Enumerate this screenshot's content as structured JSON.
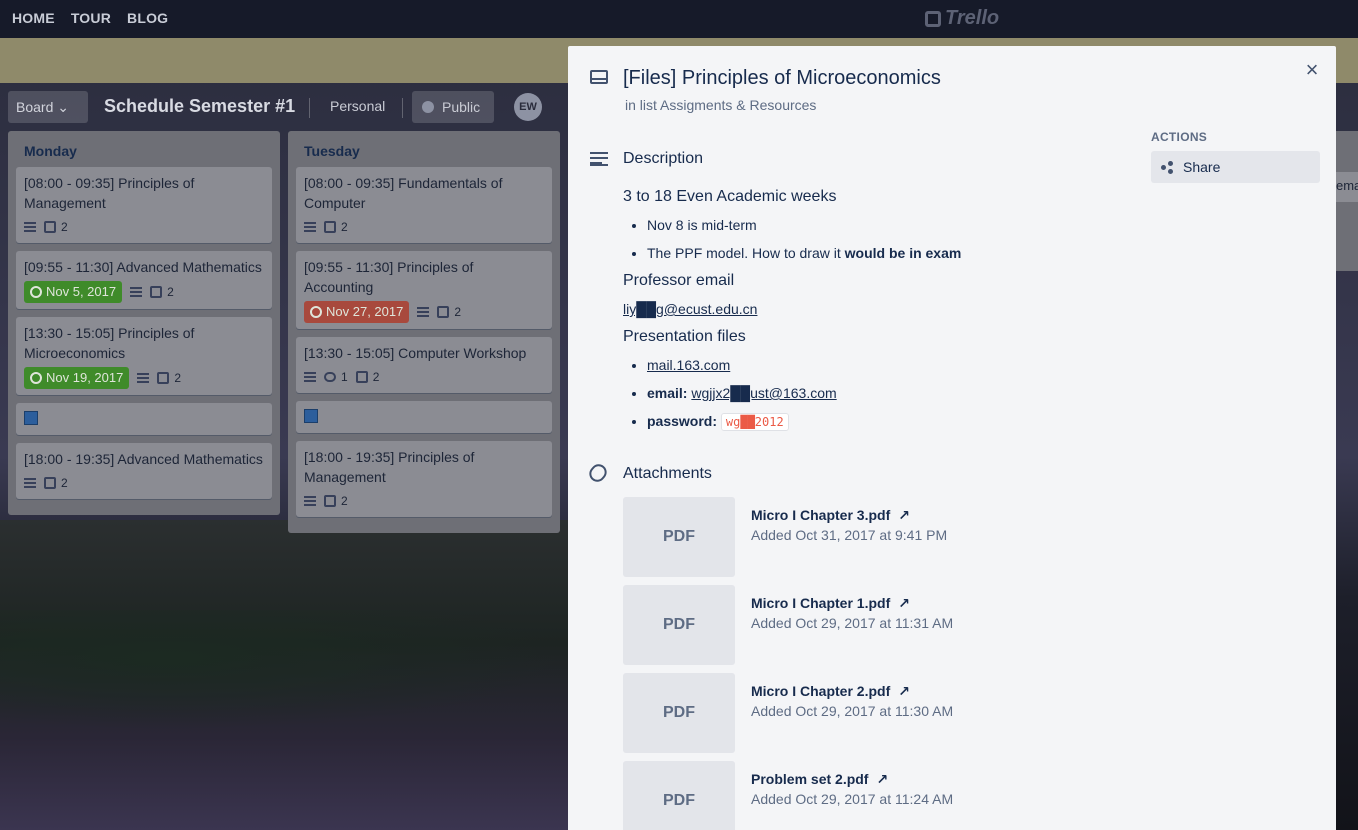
{
  "topnav": {
    "links": [
      "HOME",
      "TOUR",
      "BLOG"
    ],
    "logo": "Trello"
  },
  "board": {
    "switcher_label": "Board",
    "title": "Schedule Semester #1",
    "team": "Personal",
    "visibility": "Public",
    "avatar_initials": "EW"
  },
  "lists": [
    {
      "title": "Monday",
      "cards": [
        {
          "title": "[08:00 - 09:35] Principles of Management",
          "attachments": "2"
        },
        {
          "title": "[09:55 - 11:30] Advanced Mathematics",
          "due": "Nov 5, 2017",
          "due_status": "complete",
          "attachments": "2"
        },
        {
          "title": "[13:30 - 15:05] Principles of Microeconomics",
          "due": "Nov 19, 2017",
          "due_status": "complete",
          "attachments": "2"
        },
        {
          "title": "[18:00 - 19:35] Advanced Mathematics",
          "attachments": "2"
        }
      ]
    },
    {
      "title": "Tuesday",
      "cards": [
        {
          "title": "[08:00 - 09:35] Fundamentals of Computer",
          "attachments": "2"
        },
        {
          "title": "[09:55 - 11:30] Principles of Accounting",
          "due": "Nov 27, 2017",
          "due_status": "overdue",
          "attachments": "2"
        },
        {
          "title": "[13:30 - 15:05] Computer Workshop",
          "comments": "1",
          "attachments": "2"
        },
        {
          "title": "[18:00 - 19:35] Principles of Management",
          "attachments": "2"
        }
      ]
    }
  ],
  "peek_text": "ema",
  "modal": {
    "title": "[Files] Principles of Microeconomics",
    "in_list_prefix": "in list",
    "list_name": "Assigments & Resources",
    "description_heading": "Description",
    "description": {
      "h1": "3 to 18 Even Academic weeks",
      "bullets": [
        "Nov 8 is mid-term",
        "The PPF model. How to draw it "
      ],
      "bullet2_bold": "would be in exam",
      "h2": "Professor email",
      "prof_email": "liy██g@ecust.edu.cn",
      "h3": "Presentation files",
      "link1": "mail.163.com",
      "email_label": "email:",
      "email_value": "wgjjx2██ust@163.com",
      "password_label": "password:",
      "password_value": "wg██2012"
    },
    "attachments_heading": "Attachments",
    "attachments": [
      {
        "thumb": "PDF",
        "name": "Micro I Chapter 3.pdf",
        "added": "Added Oct 31, 2017 at 9:41 PM"
      },
      {
        "thumb": "PDF",
        "name": "Micro I Chapter 1.pdf",
        "added": "Added Oct 29, 2017 at 11:31 AM"
      },
      {
        "thumb": "PDF",
        "name": "Micro I Chapter 2.pdf",
        "added": "Added Oct 29, 2017 at 11:30 AM"
      },
      {
        "thumb": "PDF",
        "name": "Problem set 2.pdf",
        "added": "Added Oct 29, 2017 at 11:24 AM"
      }
    ],
    "actions_label": "ACTIONS",
    "share_label": "Share",
    "external_arrow": "↗",
    "close_glyph": "×"
  },
  "colors": {
    "due_complete": "#61bd4f",
    "due_overdue": "#eb5a46",
    "nav_bg": "#161a29"
  }
}
